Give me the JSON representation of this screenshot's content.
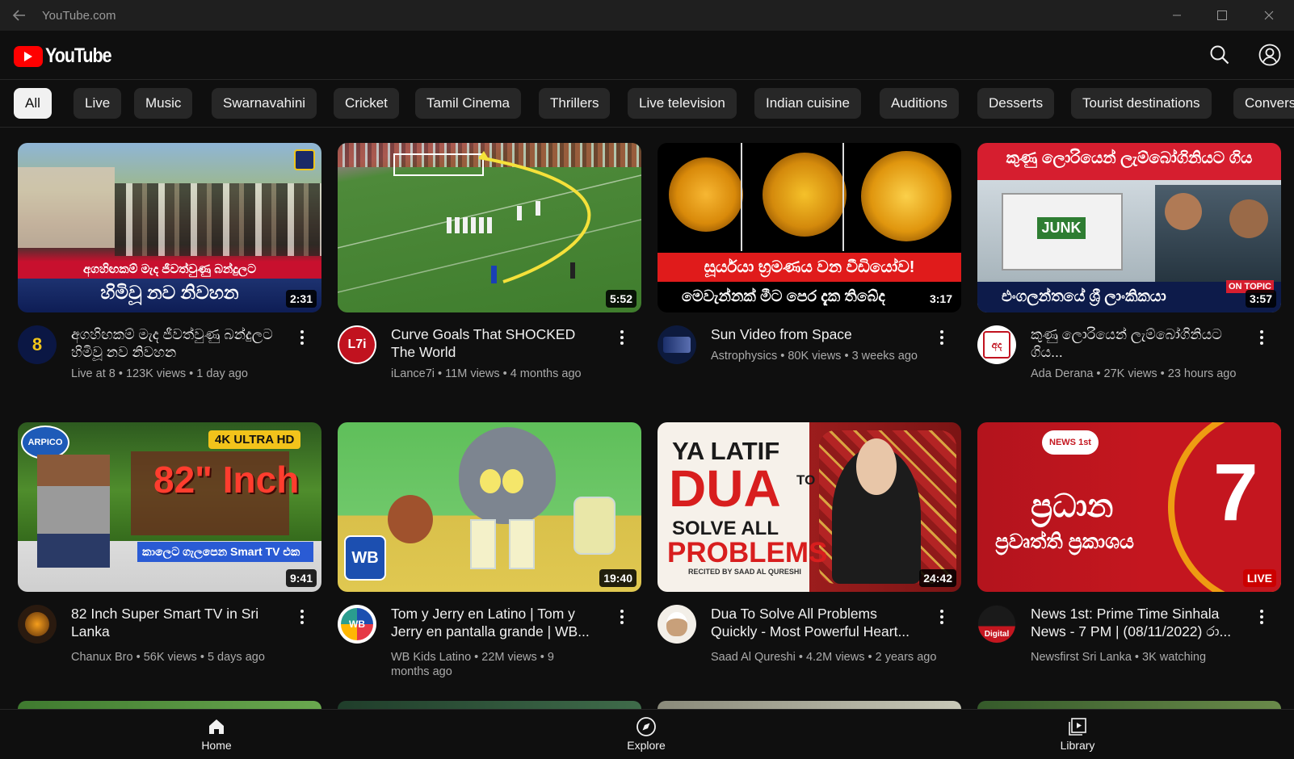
{
  "window": {
    "title": "YouTube.com"
  },
  "header": {
    "logo_text": "YouTube",
    "brand_color": "#ff0000"
  },
  "chips": [
    "All",
    "Live",
    "Music",
    "Swarnavahini",
    "Cricket",
    "Tamil Cinema",
    "Thrillers",
    "Live television",
    "Indian cuisine",
    "Auditions",
    "Desserts",
    "Tourist destinations",
    "Convers"
  ],
  "videos": [
    {
      "title": "අගහිඟකම් මැද ජීවත්වුණු බන්දුලට හිමිවූ නව නිවහන",
      "channel": "Live at 8",
      "views": "123K views",
      "age": "1 day ago",
      "duration": "2:31",
      "thumb_text": [
        "අගහිඟකම් මැද ජීවත්වුණු බන්දුලට",
        "හිමිවූ නව නිවහන"
      ]
    },
    {
      "title": "Curve Goals That SHOCKED The World",
      "channel": "iLance7i",
      "views": "11M views",
      "age": "4 months ago",
      "duration": "5:52",
      "avatar_text": "L7i"
    },
    {
      "title": "Sun Video from Space",
      "channel": "Astrophysics",
      "views": "80K views",
      "age": "3 weeks ago",
      "duration": "3:17",
      "thumb_text": [
        "සූර්යයා භ්‍රමණය වන වීඩියෝව!",
        "මෙවැන්නක් මීට පෙර දැක තිබේද"
      ]
    },
    {
      "title": "කුණු ලොරියෙන් ලැම්බෝගිනියට ගිය...",
      "channel": "Ada Derana",
      "views": "27K views",
      "age": "23 hours ago",
      "duration": "3:57",
      "thumb_text": [
        "කුණු ලොරියෙන් ලැම්බෝගිනියට ගිය",
        "එංගලන්තයේ ශ්‍රී ලාංකිකයා",
        "JUNK",
        "ON TOPIC"
      ]
    },
    {
      "title": "82 Inch Super Smart TV in Sri Lanka",
      "channel": "Chanux Bro",
      "views": "56K views",
      "age": "5 days ago",
      "duration": "9:41",
      "thumb_text": [
        "ARPICO",
        "4K ULTRA HD",
        "82\" Inch",
        "කාලෙට ගැලපෙන Smart TV එක"
      ]
    },
    {
      "title": "Tom y Jerry en Latino | Tom y Jerry en pantalla grande | WB...",
      "channel": "WB Kids Latino",
      "views": "22M views",
      "age": "9 months ago",
      "duration": "19:40",
      "thumb_text": [
        "WB"
      ]
    },
    {
      "title": "Dua To Solve All Problems Quickly - Most Powerful Heart...",
      "channel": "Saad Al Qureshi",
      "views": "4.2M views",
      "age": "2 years ago",
      "duration": "24:42",
      "thumb_text": [
        "YA LATIF",
        "DUA",
        "TO",
        "SOLVE ALL",
        "PROBLEMS",
        "RECITED BY SAAD AL QURESHI"
      ]
    },
    {
      "title": "News 1st: Prime Time Sinhala News - 7 PM | (08/11/2022) රා...",
      "channel": "Newsfirst Sri Lanka",
      "views": "3K watching",
      "age": "",
      "duration": "LIVE",
      "thumb_text": [
        "ප්‍රධාන",
        "ප්‍රවෘත්ති ප්‍රකාශය",
        "7",
        "NEWS 1st"
      ],
      "avatar_text": "Digital"
    }
  ],
  "bottom_nav": [
    "Home",
    "Explore",
    "Library"
  ]
}
